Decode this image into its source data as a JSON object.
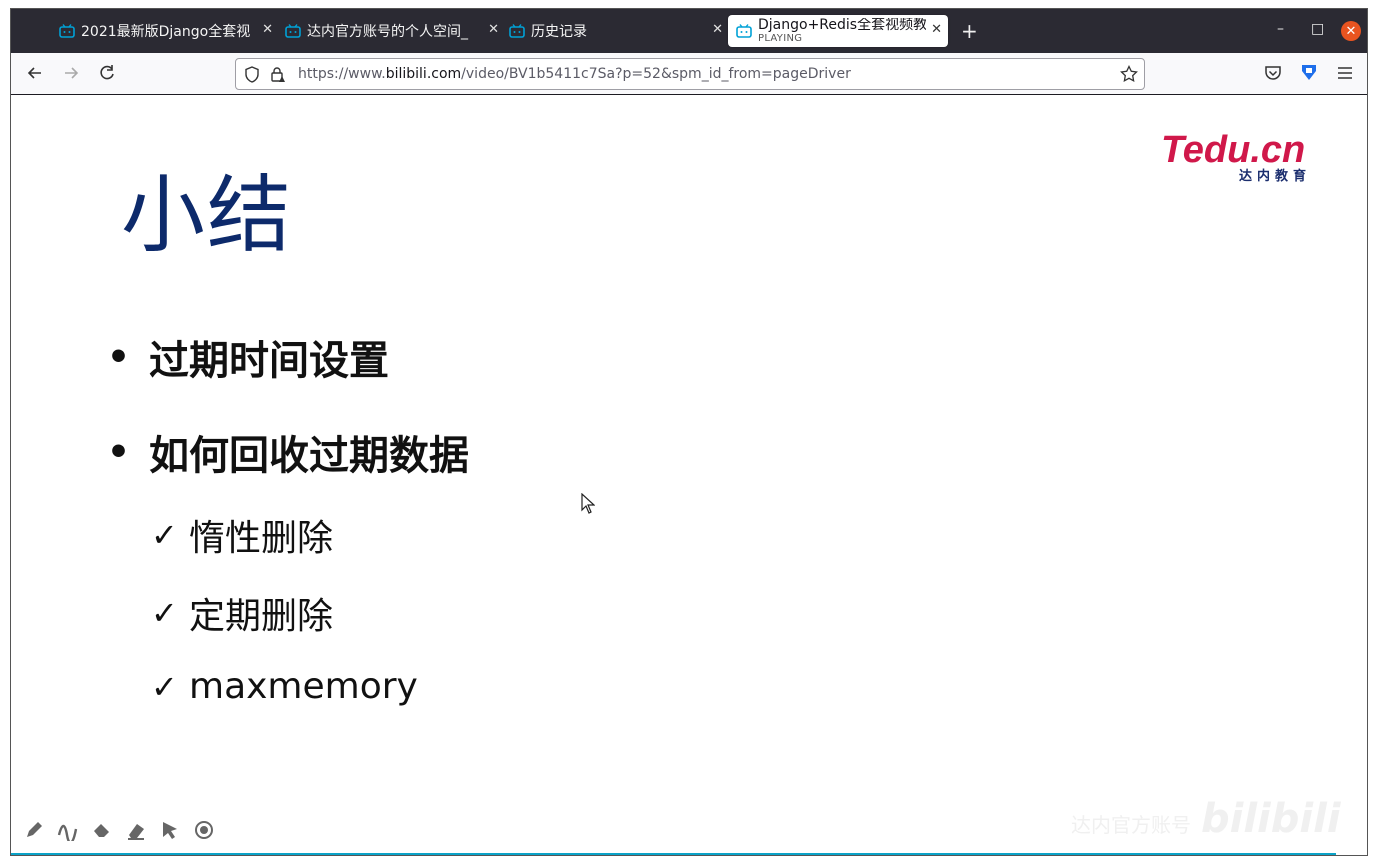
{
  "browser": {
    "tabs": [
      {
        "label": "2021最新版Django全套视"
      },
      {
        "label": "达内官方账号的个人空间_"
      },
      {
        "label": "历史记录"
      },
      {
        "label": "Django+Redis全套视频教",
        "status": "PLAYING"
      }
    ],
    "url_prefix": "https://www.",
    "url_host": "bilibili.com",
    "url_path": "/video/BV1b5411c7Sa?p=52&spm_id_from=pageDriver"
  },
  "slide": {
    "title": "小结",
    "logo_text": "Tedu.cn",
    "logo_sub": "达内教育",
    "bullets": [
      {
        "text": "过期时间设置"
      },
      {
        "text": "如何回收过期数据"
      }
    ],
    "checks": [
      {
        "text": "惰性删除"
      },
      {
        "text": "定期删除"
      },
      {
        "text": "maxmemory"
      }
    ],
    "bullet_glyph": "•",
    "check_glyph": "✓"
  },
  "watermark": {
    "text": "达内官方账号",
    "brand": "bilibili"
  },
  "colors": {
    "title": "#0d2a6b",
    "logo_red": "#d0184a",
    "logo_navy": "#1b2e6e",
    "tab_bar": "#2b2a33",
    "progress": "#0aa3c8"
  }
}
